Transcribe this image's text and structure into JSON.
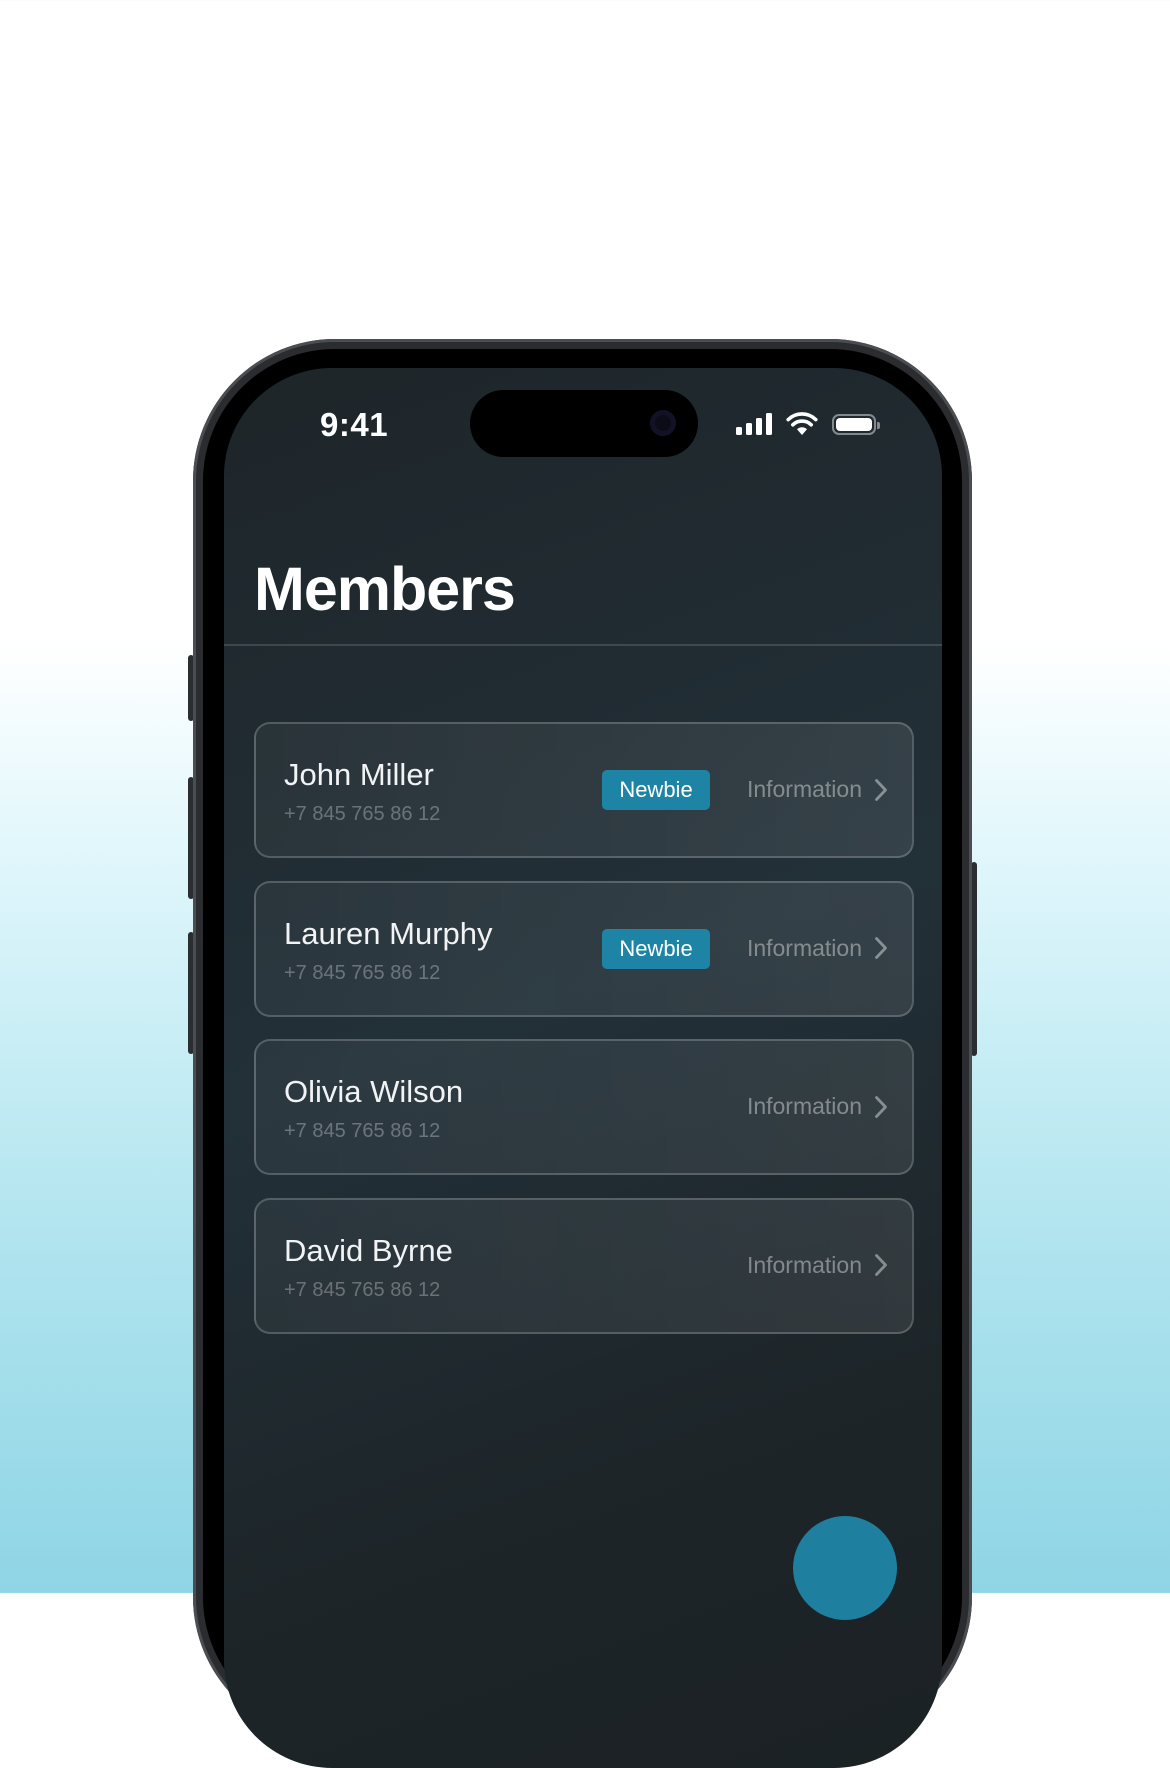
{
  "status_bar": {
    "time": "9:41",
    "icons": [
      "signal-icon",
      "wifi-icon",
      "battery-icon"
    ]
  },
  "header": {
    "title": "Members"
  },
  "members": [
    {
      "name": "John Miller",
      "phone": "+7 845 765 86 12",
      "badge": "Newbie",
      "action": "Information"
    },
    {
      "name": "Lauren Murphy",
      "phone": "+7 845 765 86 12",
      "badge": "Newbie",
      "action": "Information"
    },
    {
      "name": "Olivia Wilson",
      "phone": "+7 845 765 86 12",
      "action": "Information"
    },
    {
      "name": "David Byrne",
      "phone": "+7 845 765 86 12",
      "action": "Information"
    }
  ],
  "colors": {
    "accent": "#1e84a6",
    "screen_background": "#1e2529",
    "page_gradient_end": "#8fd5e5"
  }
}
